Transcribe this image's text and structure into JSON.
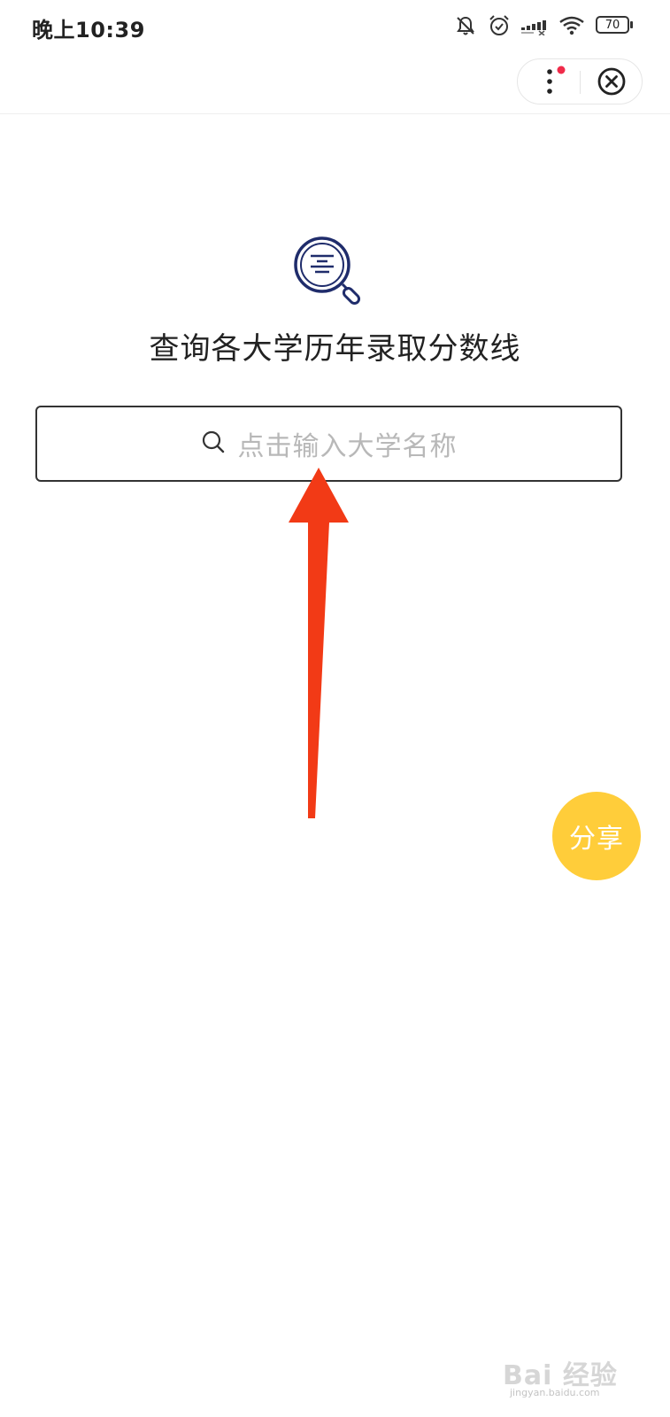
{
  "status_bar": {
    "time": "晚上10:39",
    "battery": "70",
    "icons": [
      "bell-muted-icon",
      "alarm-icon",
      "signal-icon",
      "wifi-icon",
      "battery-icon"
    ]
  },
  "header": {
    "more_icon": "more-vertical-icon",
    "close_icon": "close-circle-icon",
    "notification_dot_color": "#f02b4a"
  },
  "main": {
    "logo_icon": "search-document-icon",
    "title": "查询各大学历年录取分数线",
    "search": {
      "icon": "search-icon",
      "placeholder": "点击输入大学名称"
    }
  },
  "annotation": {
    "arrow_color": "#f23a16"
  },
  "share": {
    "label": "分享",
    "color": "#ffcd3a"
  },
  "watermark": {
    "text": "Bai 经验",
    "sub": "jingyan.baidu.com"
  }
}
